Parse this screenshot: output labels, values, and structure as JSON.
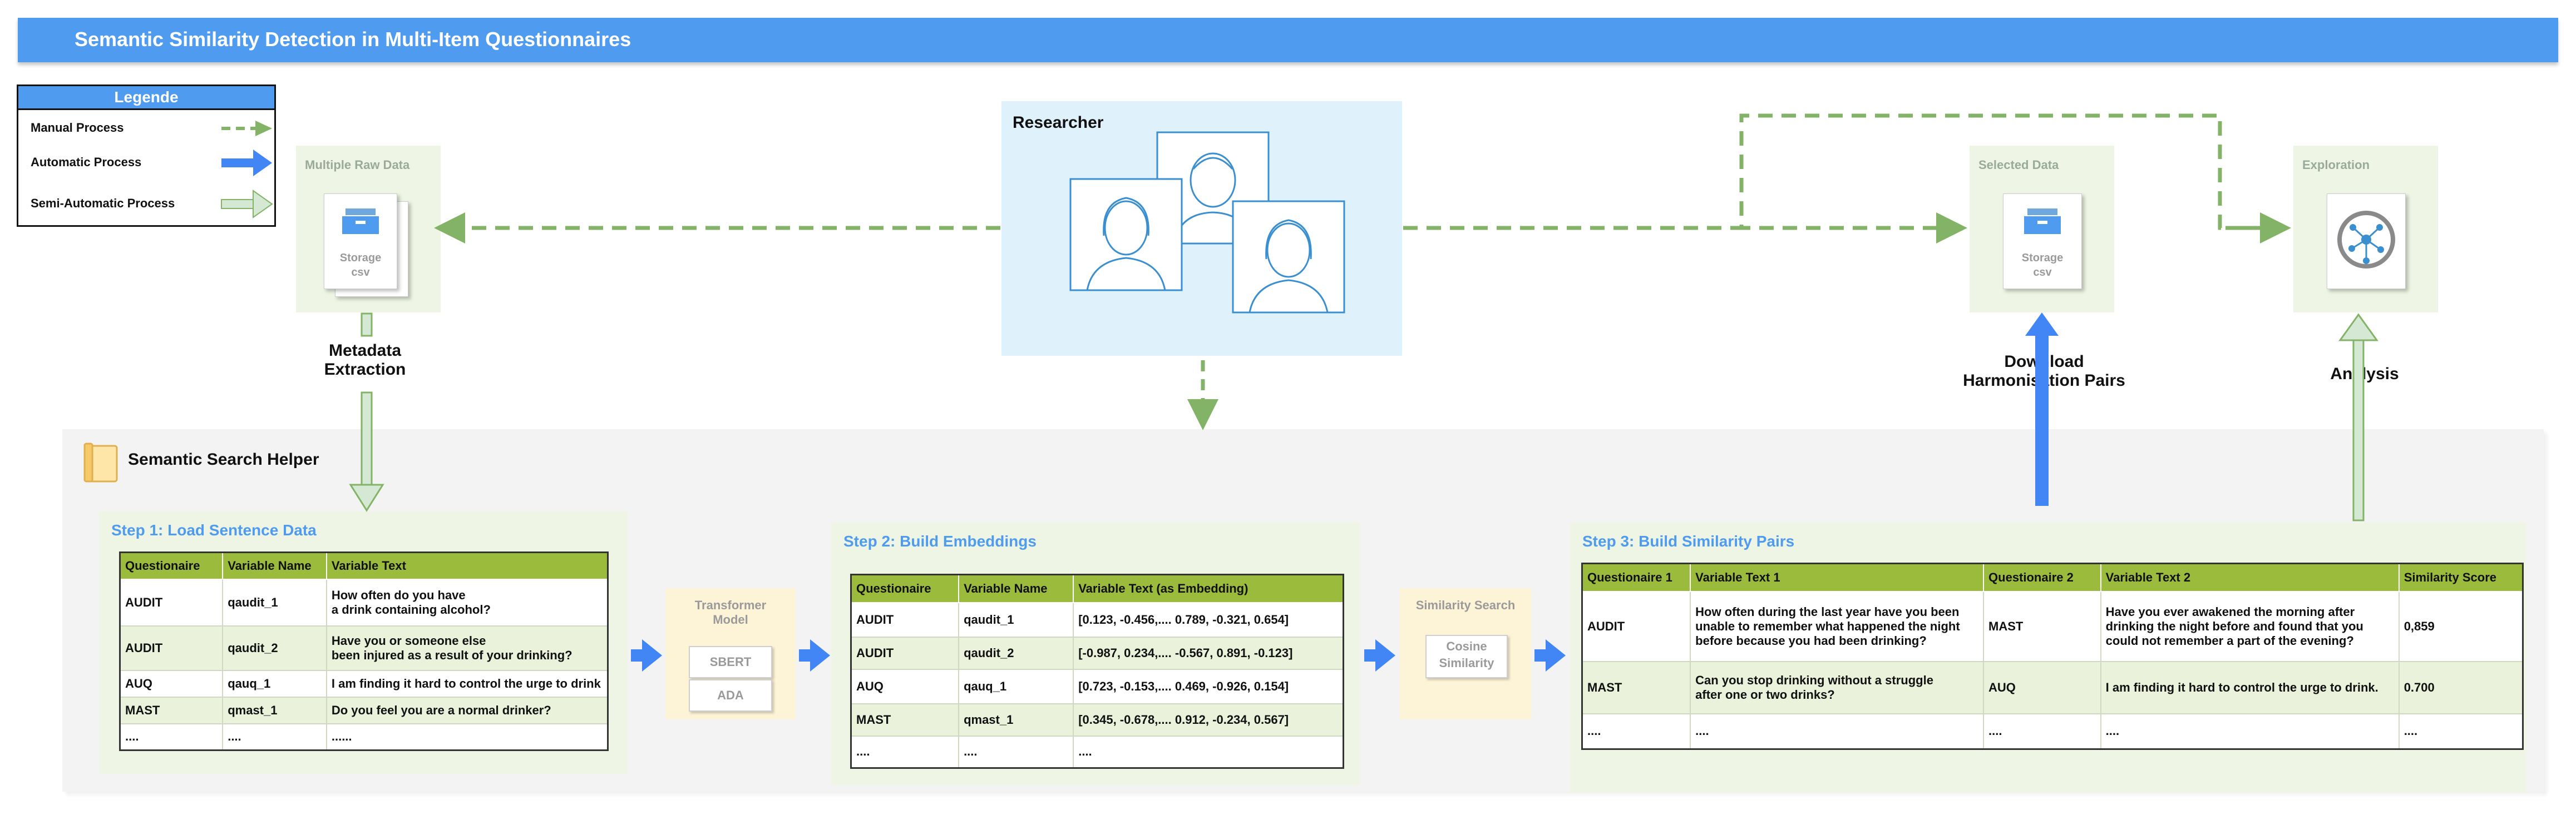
{
  "title": "Semantic Similarity Detection in Multi-Item Questionnaires",
  "legend": {
    "title": "Legende",
    "items": [
      {
        "label": "Manual Process",
        "style": "dashed",
        "color": "#82b366"
      },
      {
        "label": "Automatic Process",
        "style": "solid",
        "color": "#4285f4"
      },
      {
        "label": "Semi-Automatic Process",
        "style": "outline",
        "color": "#d5e8d4"
      }
    ]
  },
  "raw_data": {
    "label": "Multiple Raw Data",
    "storage": "Storage",
    "format": "csv"
  },
  "researcher": {
    "label": "Researcher"
  },
  "selected_data": {
    "label": "Selected Data",
    "storage": "Storage",
    "format": "csv"
  },
  "exploration": {
    "label": "Exploration"
  },
  "captions": {
    "metadata": [
      "Metadata",
      "Extraction"
    ],
    "download": [
      "Download",
      "Harmonisation Pairs"
    ],
    "analysis": "Analysis"
  },
  "helper": {
    "title": "Semantic Search Helper"
  },
  "step1": {
    "title": "Step 1: Load Sentence Data",
    "headers": [
      "Questionaire",
      "Variable Name",
      "Variable Text"
    ],
    "rows": [
      [
        "AUDIT",
        "qaudit_1",
        "How often do you have\na drink containing alcohol?"
      ],
      [
        "AUDIT",
        "qaudit_2",
        "Have you or someone else\nbeen injured as a result of your drinking?"
      ],
      [
        "AUQ",
        "qauq_1",
        "I am finding it hard to control the urge to drink"
      ],
      [
        "MAST",
        "qmast_1",
        "Do you feel you are a normal drinker?"
      ],
      [
        "....",
        "....",
        "......"
      ]
    ]
  },
  "transformer": {
    "label": "Transformer\nModel",
    "options": [
      "SBERT",
      "ADA"
    ]
  },
  "step2": {
    "title": "Step 2: Build Embeddings",
    "headers": [
      "Questionaire",
      "Variable Name",
      "Variable Text (as Embedding)"
    ],
    "rows": [
      [
        "AUDIT",
        "qaudit_1",
        "[0.123, -0.456,.... 0.789, -0.321, 0.654]"
      ],
      [
        "AUDIT",
        "qaudit_2",
        "[-0.987, 0.234,.... -0.567, 0.891, -0.123]"
      ],
      [
        "AUQ",
        "qauq_1",
        "[0.723, -0.153,.... 0.469, -0.926, 0.154]"
      ],
      [
        "MAST",
        "qmast_1",
        "[0.345, -0.678,.... 0.912, -0.234, 0.567]"
      ],
      [
        "....",
        "....",
        "...."
      ]
    ]
  },
  "similarity": {
    "label": "Similarity Search",
    "button": "Cosine\nSimilarity"
  },
  "step3": {
    "title": "Step 3: Build Similarity Pairs",
    "headers": [
      "Questionaire 1",
      "Variable Text 1",
      "Questionaire 2",
      "Variable Text 2",
      "Similarity Score"
    ],
    "rows": [
      [
        "AUDIT",
        "How often during the last year have you been\nunable to remember what happened the night\nbefore because you had been drinking?",
        "MAST",
        "Have you ever awakened the morning after\ndrinking the night before and found that you\ncould not remember a part of the evening?",
        "0,859"
      ],
      [
        "MAST",
        "Can you stop drinking without a struggle\nafter one or two drinks?",
        "AUQ",
        "I am finding it hard to control the urge to drink.",
        "0.700"
      ],
      [
        "....",
        "....",
        "....",
        "....",
        "...."
      ]
    ]
  },
  "colors": {
    "blue": "#4e9bef",
    "arrow_blue": "#4285f4",
    "dash_green": "#82b366",
    "header_green": "#9bbb3c"
  }
}
